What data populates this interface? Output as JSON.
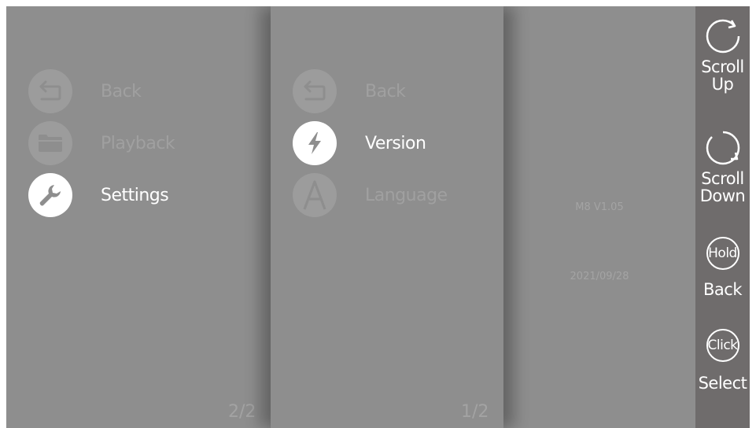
{
  "panel_1": {
    "items": [
      {
        "label": "Back",
        "icon": "back-arrow-icon",
        "state": "dim"
      },
      {
        "label": "Playback",
        "icon": "folder-icon",
        "state": "dim"
      },
      {
        "label": "Settings",
        "icon": "wrench-icon",
        "state": "selected"
      }
    ],
    "page": "2/2"
  },
  "panel_2": {
    "items": [
      {
        "label": "Back",
        "icon": "back-arrow-icon",
        "state": "dim"
      },
      {
        "label": "Version",
        "icon": "lightning-icon",
        "state": "selected"
      },
      {
        "label": "Language",
        "icon": "letter-a-icon",
        "state": "dim"
      }
    ],
    "page": "1/2"
  },
  "panel_3": {
    "version": "M8 V1.05",
    "date": "2021/09/28"
  },
  "sidebar": {
    "scroll_up": {
      "line1": "Scroll",
      "line2": "Up"
    },
    "scroll_down": {
      "line1": "Scroll",
      "line2": "Down"
    },
    "hold": {
      "ring": "Hold",
      "label": "Back"
    },
    "click": {
      "ring": "Click",
      "label": "Select"
    }
  },
  "colors": {
    "background": "#8e8e8e",
    "sidebar": "#6f6c6c",
    "dim_text": "#a0a0a0",
    "active_text": "#ffffff"
  }
}
